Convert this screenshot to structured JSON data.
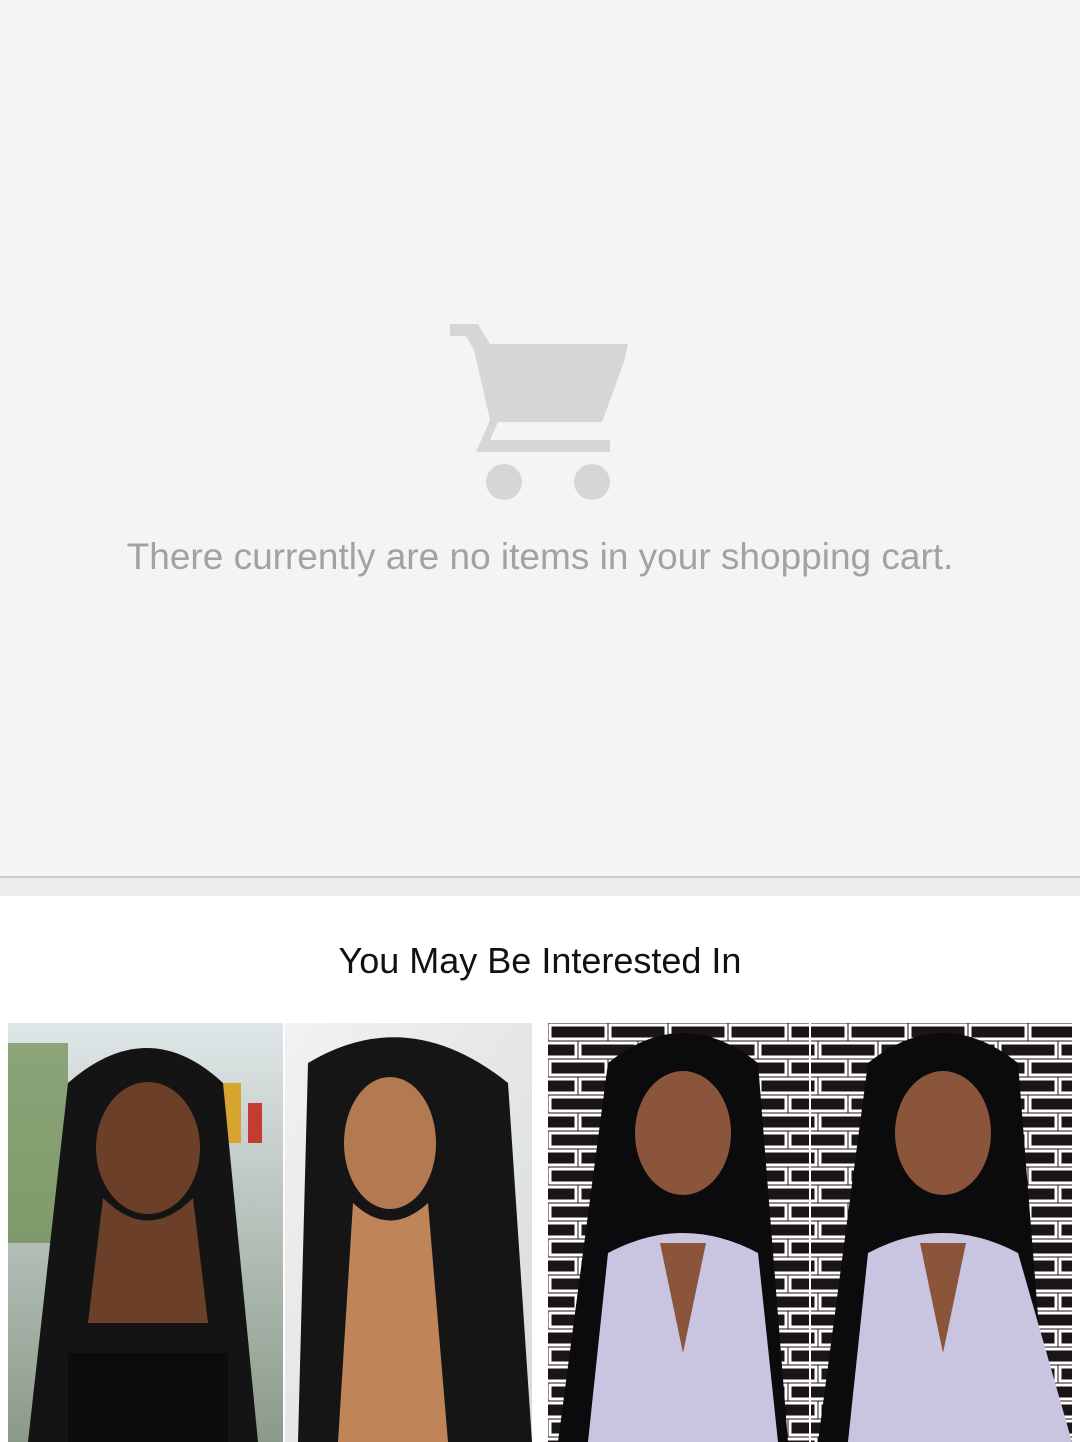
{
  "empty_cart": {
    "icon": "shopping-cart-icon",
    "message": "There currently are no items in your shopping cart."
  },
  "recommendations": {
    "title": "You May Be Interested In",
    "products": [
      {
        "image": "curly-wig-photo"
      },
      {
        "image": "straight-wig-photo"
      }
    ]
  },
  "colors": {
    "empty_bg": "#f4f4f4",
    "icon": "#d6d6d6",
    "message_text": "#a2a2a2"
  }
}
